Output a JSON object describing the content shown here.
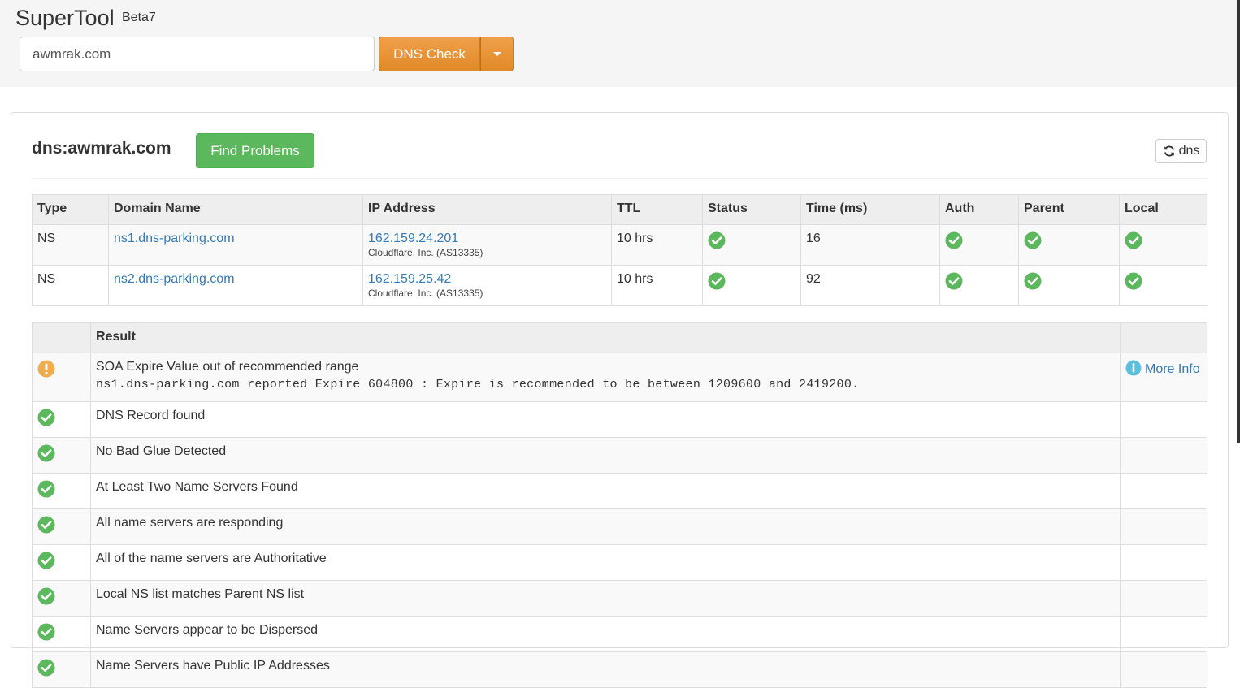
{
  "app": {
    "title": "SuperTool",
    "badge": "Beta7"
  },
  "search": {
    "value": "awmrak.com",
    "placeholder": ""
  },
  "actions": {
    "primary_label": "DNS Check"
  },
  "panel": {
    "title": "dns:awmrak.com",
    "find_button_label": "Find Problems",
    "refresh_label": "dns"
  },
  "ns_table": {
    "headers": [
      "Type",
      "Domain Name",
      "IP Address",
      "TTL",
      "Status",
      "Time (ms)",
      "Auth",
      "Parent",
      "Local"
    ],
    "rows": [
      {
        "type": "NS",
        "domain": "ns1.dns-parking.com",
        "ip": "162.159.24.201",
        "ip_org": "Cloudflare, Inc. (AS13335)",
        "ttl": "10 hrs",
        "status": "ok",
        "time": "16",
        "auth": "ok",
        "parent": "ok",
        "local": "ok"
      },
      {
        "type": "NS",
        "domain": "ns2.dns-parking.com",
        "ip": "162.159.25.42",
        "ip_org": "Cloudflare, Inc. (AS13335)",
        "ttl": "10 hrs",
        "status": "ok",
        "time": "92",
        "auth": "ok",
        "parent": "ok",
        "local": "ok"
      }
    ]
  },
  "results": {
    "header": "Result",
    "more_info_label": "More Info",
    "rows": [
      {
        "status": "warning",
        "text": "SOA Expire Value out of recommended range",
        "detail": "ns1.dns-parking.com reported Expire 604800 : Expire is recommended to be between 1209600 and 2419200."
      },
      {
        "status": "ok",
        "text": "DNS Record found"
      },
      {
        "status": "ok",
        "text": "No Bad Glue Detected"
      },
      {
        "status": "ok",
        "text": "At Least Two Name Servers Found"
      },
      {
        "status": "ok",
        "text": "All name servers are responding"
      },
      {
        "status": "ok",
        "text": "All of the name servers are Authoritative"
      },
      {
        "status": "ok",
        "text": "Local NS list matches Parent NS list"
      },
      {
        "status": "ok",
        "text": "Name Servers appear to be Dispersed"
      },
      {
        "status": "ok",
        "text": "Name Servers have Public IP Addresses"
      }
    ]
  },
  "colors": {
    "ok": "#5cb85c",
    "warning": "#f0ad4e",
    "info": "#5bc0de",
    "link": "#337ab7",
    "accent": "#e8902e"
  },
  "icons": {
    "ok": "check-circle-icon",
    "warning": "exclamation-circle-icon",
    "info": "info-circle-icon",
    "refresh": "refresh-icon",
    "caret": "caret-down-icon"
  }
}
